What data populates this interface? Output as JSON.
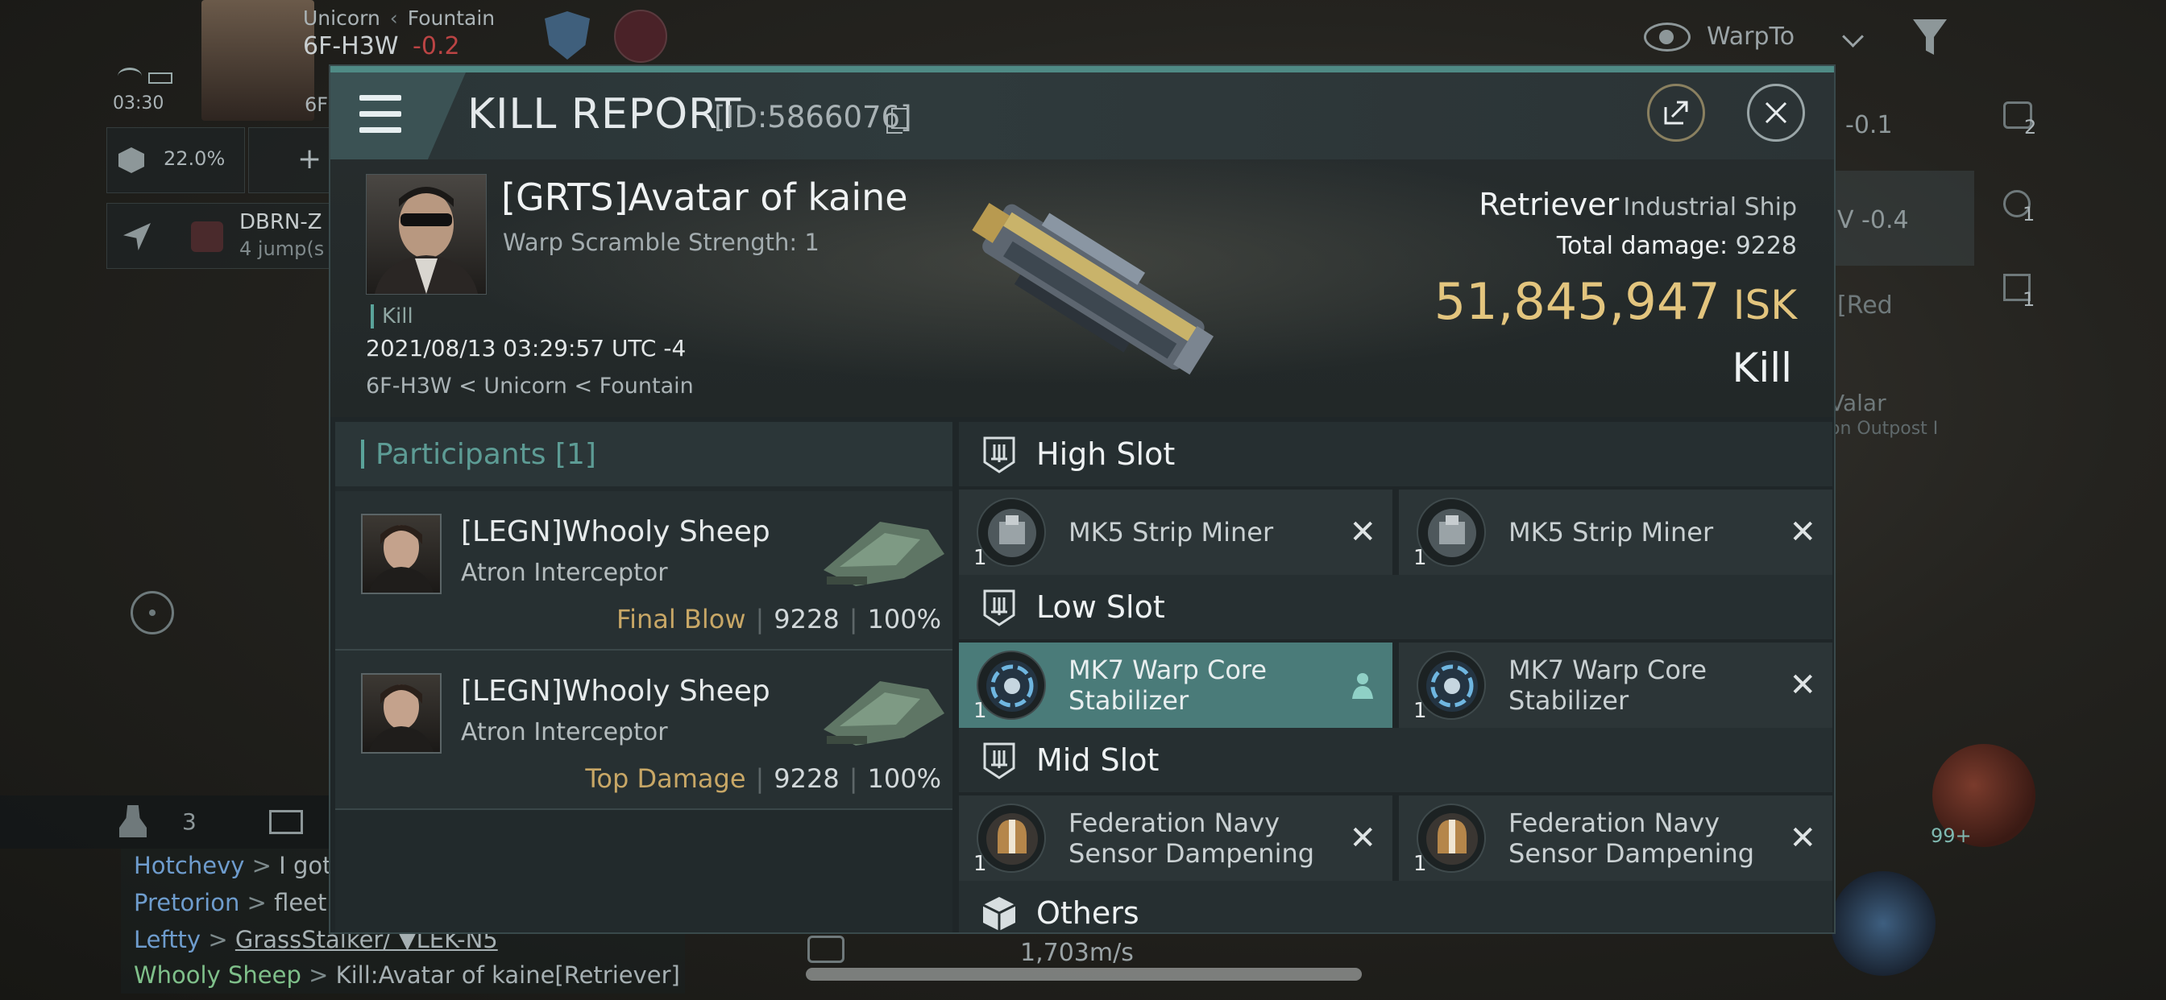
{
  "hud": {
    "location_line1": "Unicorn",
    "location_line2": "Fountain",
    "system": "6F-H3W",
    "security": "-0.2",
    "time": "03:30",
    "time_right": "6F",
    "cargo_percent": "22.0%",
    "destination": "DBRN-Z",
    "jumps": "4 jump(s",
    "warpto_label": "WarpTo",
    "right_list": [
      "-0.1",
      "V -0.4",
      "[Red",
      "Valar",
      "on Outpost I"
    ],
    "right_counts": [
      "2",
      "1",
      "1"
    ],
    "fleet_count": "3",
    "notification_badge": "99+",
    "speed": "1,703m/s"
  },
  "chat": [
    {
      "name": "Hotchevy",
      "arrow": ">",
      "msg": "I gott"
    },
    {
      "name": "Pretorion",
      "arrow": ">",
      "msg": "fleet r"
    },
    {
      "name": "Leftty",
      "arrow": ">",
      "msg": "GrassStalker/ ▼LEK-N5"
    },
    {
      "name": "Whooly Sheep",
      "arrow": ">",
      "msg": "Kill:Avatar of kaine[Retriever]"
    }
  ],
  "report": {
    "title": "KILL REPORT",
    "id": "[ID:5866076]",
    "victim_name": "[GRTS]Avatar of kaine",
    "warp_scramble": "Warp Scramble Strength: 1",
    "kill_tag": "Kill",
    "date": "2021/08/13 03:29:57 UTC -4",
    "location": "6F-H3W < Unicorn < Fountain",
    "ship_name": "Retriever",
    "ship_class": "Industrial Ship",
    "total_damage_label": "Total damage:",
    "total_damage": "9228",
    "isk_value": "51,845,947",
    "isk_unit": "ISK",
    "result": "Kill"
  },
  "participants": {
    "header": "Participants [1]",
    "rows": [
      {
        "name": "[LEGN]Whooly Sheep",
        "ship": "Atron Interceptor",
        "role": "Final Blow",
        "damage": "9228",
        "percent": "100%"
      },
      {
        "name": "[LEGN]Whooly Sheep",
        "ship": "Atron Interceptor",
        "role": "Top Damage",
        "damage": "9228",
        "percent": "100%"
      }
    ]
  },
  "slots": {
    "high": {
      "label": "High Slot",
      "modules": [
        {
          "name": "MK5 Strip Miner",
          "qty": "1",
          "status": "destroyed"
        },
        {
          "name": "MK5 Strip Miner",
          "qty": "1",
          "status": "destroyed"
        }
      ]
    },
    "low": {
      "label": "Low Slot",
      "modules": [
        {
          "name": "MK7 Warp Core Stabilizer",
          "qty": "1",
          "status": "dropped"
        },
        {
          "name": "MK7 Warp Core Stabilizer",
          "qty": "1",
          "status": "destroyed"
        }
      ]
    },
    "mid": {
      "label": "Mid Slot",
      "modules": [
        {
          "name": "Federation Navy Sensor Dampening",
          "qty": "1",
          "status": "destroyed"
        },
        {
          "name": "Federation Navy Sensor Dampening",
          "qty": "1",
          "status": "destroyed"
        }
      ]
    },
    "others": {
      "label": "Others"
    }
  },
  "colors": {
    "accent_teal": "#5aa39a",
    "isk_gold": "#e3c57e",
    "role_gold": "#c8a766",
    "active_module": "#4a7b79",
    "chat_name_blue": "#6e9ccd",
    "chat_name_green": "#7fc08a"
  }
}
